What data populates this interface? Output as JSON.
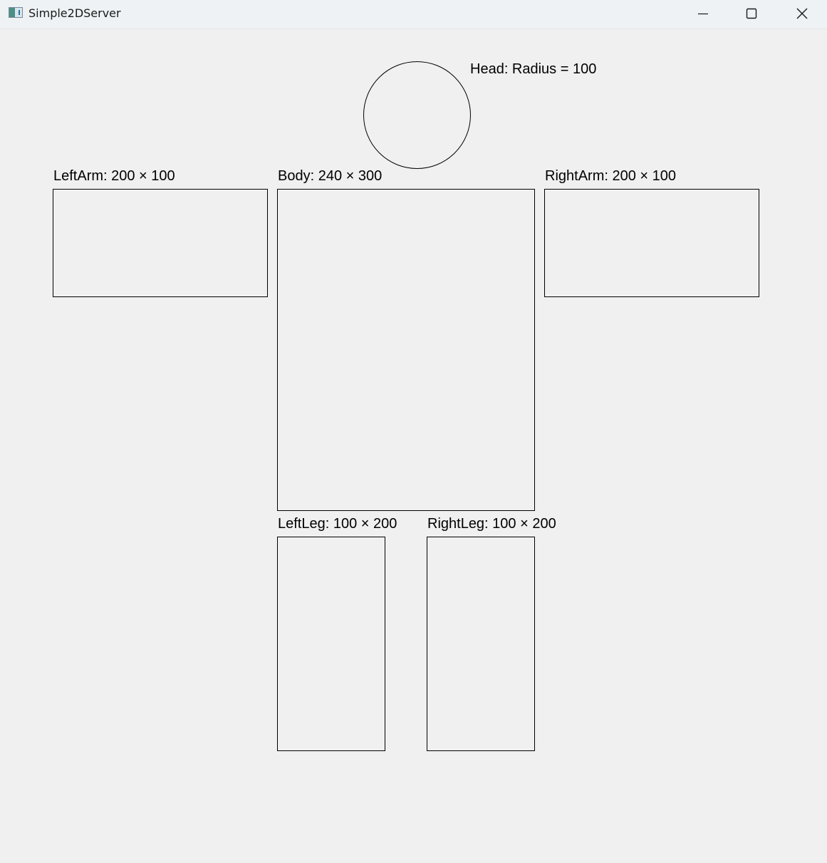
{
  "window": {
    "title": "Simple2DServer",
    "icon": "app-window-icon",
    "controls": {
      "minimize_icon": "minimize-icon",
      "maximize_icon": "maximize-icon",
      "close_icon": "close-icon"
    }
  },
  "figure": {
    "head": {
      "label": "Head: Radius = 100"
    },
    "left_arm": {
      "label": "LeftArm: 200 × 100"
    },
    "body": {
      "label": "Body: 240 × 300"
    },
    "right_arm": {
      "label": "RightArm: 200 × 100"
    },
    "left_leg": {
      "label": "LeftLeg: 100 × 200"
    },
    "right_leg": {
      "label": "RightLeg: 100 × 200"
    }
  },
  "colors": {
    "background": "#f0f0f0",
    "titlebar": "#eef2f5",
    "stroke": "#000000"
  }
}
